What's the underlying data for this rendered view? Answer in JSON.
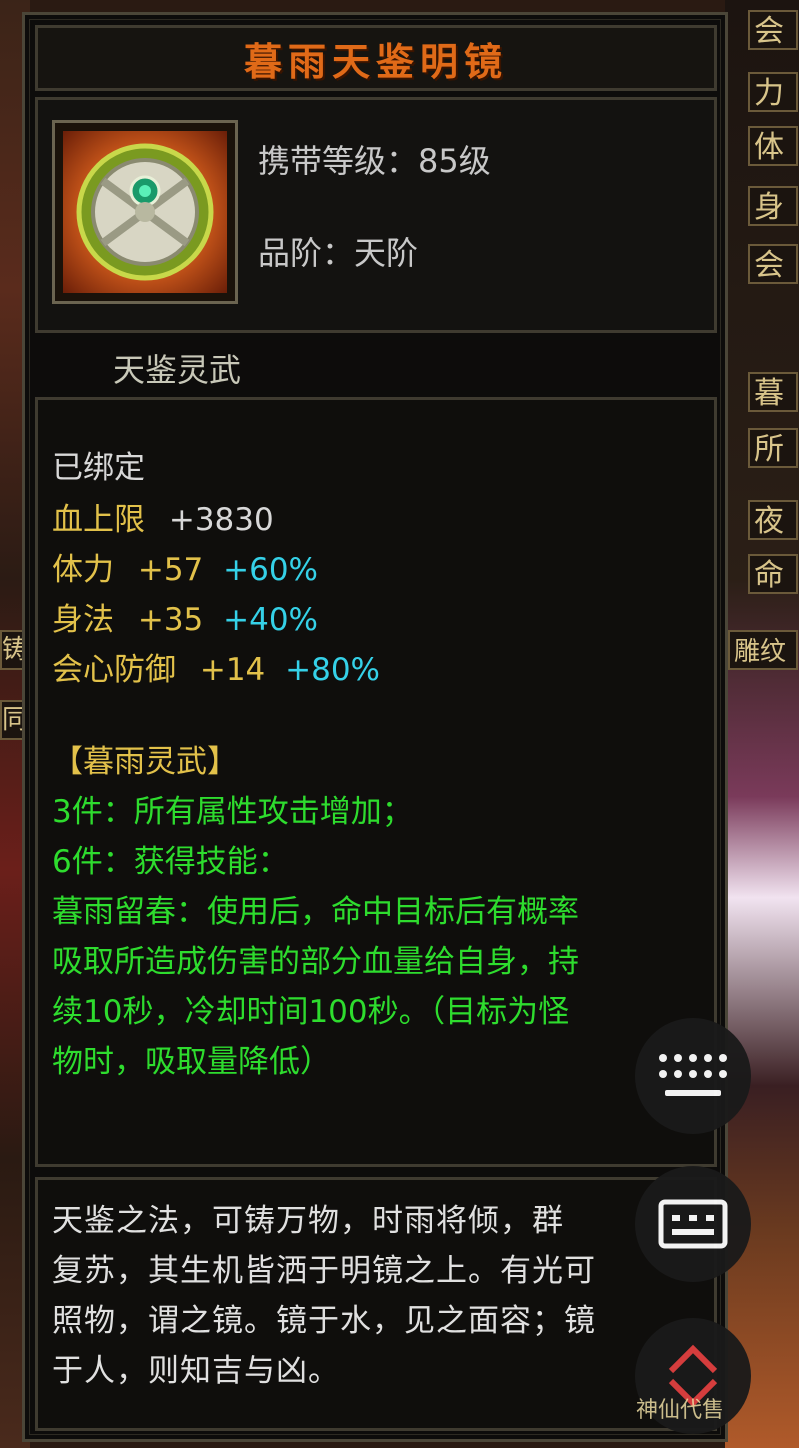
{
  "item": {
    "name": "暮雨天鉴明镜",
    "carry_level": "携带等级：85级",
    "grade": "品阶：天阶",
    "set_name": "天鉴灵武"
  },
  "attributes": {
    "bound": "已绑定",
    "hp": {
      "label": "血上限",
      "value": "+3830"
    },
    "stamina": {
      "label": "体力",
      "value": "+57",
      "percent": "+60%"
    },
    "agility": {
      "label": "身法",
      "value": "+35",
      "percent": "+40%"
    },
    "crit_def": {
      "label": "会心防御",
      "value": "+14",
      "percent": "+80%"
    }
  },
  "set_bonus": {
    "title": "【暮雨灵武】",
    "line1": "3件：所有属性攻击增加；",
    "line2": "6件：获得技能：",
    "line3": "暮雨留春：使用后，命中目标后有概率",
    "line4": "吸取所造成伤害的部分血量给自身，持",
    "line5": "续10秒，冷却时间100秒。（目标为怪",
    "line6": "物时，吸取量降低）"
  },
  "lore": {
    "line1": "天鉴之法，可铸万物，时雨将倾，群",
    "line2": "复苏，其生机皆洒于明镜之上。有光可",
    "line3": "照物，谓之镜。镜于水，见之面容；镜",
    "line4": "于人，则知吉与凶。"
  },
  "side_tabs": [
    "会",
    "力",
    "体",
    "身",
    "会",
    "暮",
    "所",
    "夜",
    "命",
    "雕纹"
  ],
  "left_tabs": [
    "同",
    "铸"
  ],
  "watermark": "神仙代售",
  "colors": {
    "title": "#e06a18",
    "gold": "#e2c14a",
    "cyan": "#35d1e8",
    "green": "#2edc2e"
  }
}
